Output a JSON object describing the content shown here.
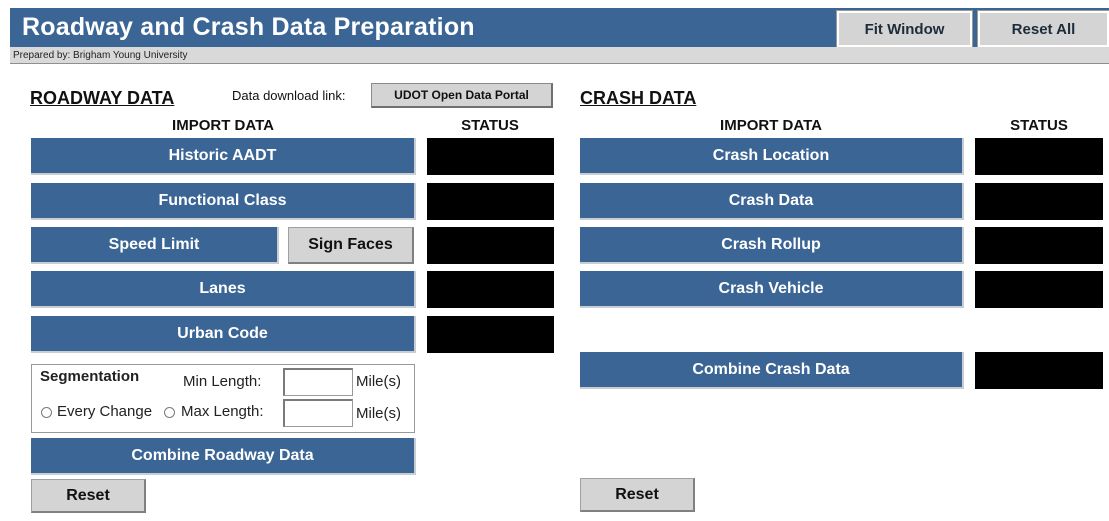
{
  "header": {
    "title": "Roadway and Crash Data Preparation",
    "fit_window": "Fit Window",
    "reset_all": "Reset All",
    "prepared_by": "Prepared by: Brigham Young University"
  },
  "roadway": {
    "section_title": "ROADWAY DATA",
    "download_label": "Data download link:",
    "download_button": "UDOT Open Data Portal",
    "import_header": "IMPORT DATA",
    "status_header": "STATUS",
    "buttons": {
      "historic_aadt": "Historic AADT",
      "functional_class": "Functional Class",
      "speed_limit": "Speed Limit",
      "sign_faces": "Sign Faces",
      "lanes": "Lanes",
      "urban_code": "Urban Code",
      "combine": "Combine Roadway Data",
      "reset": "Reset"
    },
    "segmentation": {
      "title": "Segmentation",
      "min_length_label": "Min Length:",
      "max_length_label": "Max Length:",
      "every_change_label": "Every Change",
      "unit_min": "Mile(s)",
      "unit_max": "Mile(s)",
      "min_value": "",
      "max_value": ""
    }
  },
  "crash": {
    "section_title": "CRASH DATA",
    "import_header": "IMPORT DATA",
    "status_header": "STATUS",
    "buttons": {
      "crash_location": "Crash Location",
      "crash_data": "Crash Data",
      "crash_rollup": "Crash Rollup",
      "crash_vehicle": "Crash Vehicle",
      "combine": "Combine Crash Data",
      "reset": "Reset"
    }
  },
  "colors": {
    "primary_blue": "#3b6595",
    "status_black": "#000000",
    "button_gray": "#d4d4d4"
  }
}
